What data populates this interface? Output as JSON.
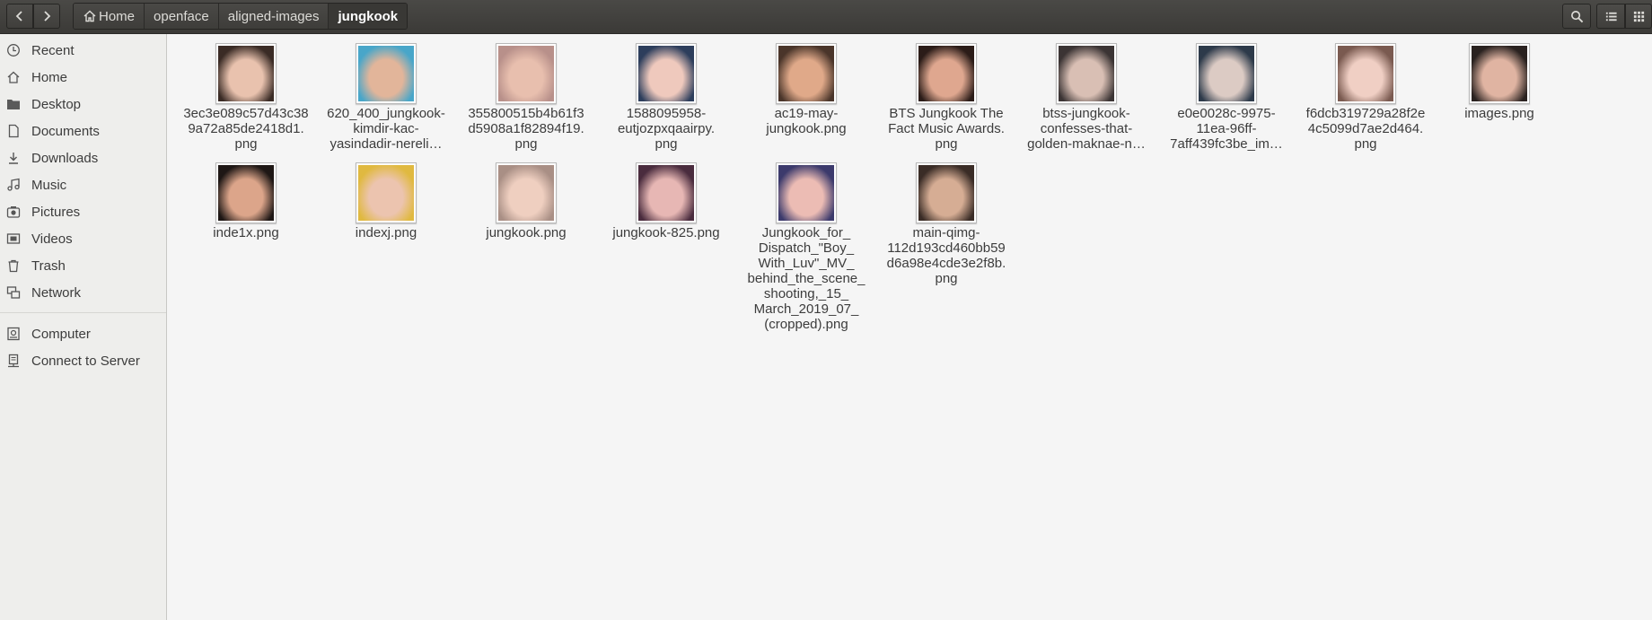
{
  "breadcrumb": [
    "Home",
    "openface",
    "aligned-images",
    "jungkook"
  ],
  "sidebar": {
    "items": [
      {
        "label": "Recent",
        "icon": "clock-icon"
      },
      {
        "label": "Home",
        "icon": "home-icon"
      },
      {
        "label": "Desktop",
        "icon": "folder-icon"
      },
      {
        "label": "Documents",
        "icon": "document-icon"
      },
      {
        "label": "Downloads",
        "icon": "download-icon"
      },
      {
        "label": "Music",
        "icon": "music-icon"
      },
      {
        "label": "Pictures",
        "icon": "camera-icon"
      },
      {
        "label": "Videos",
        "icon": "video-icon"
      },
      {
        "label": "Trash",
        "icon": "trash-icon"
      },
      {
        "label": "Network",
        "icon": "network-icon"
      }
    ],
    "devices": [
      {
        "label": "Computer",
        "icon": "computer-icon"
      },
      {
        "label": "Connect to Server",
        "icon": "server-icon"
      }
    ]
  },
  "files": [
    {
      "name": "3ec3e089c57d43c38\n9a72a85de2418d1.\npng",
      "tones": [
        "#e9c2ae",
        "#3a2b25"
      ]
    },
    {
      "name": "620_400_jungkook-\nkimdir-kac-\nyasindadir-nereli…",
      "tones": [
        "#e2b59a",
        "#48a6c9"
      ]
    },
    {
      "name": "355800515b4b61f3\nd5908a1f82894f19.\npng",
      "tones": [
        "#e8bfae",
        "#b8908a"
      ]
    },
    {
      "name": "1588095958-\neutjozpxqaairpy.\npng",
      "tones": [
        "#efc9bd",
        "#2d3e5c"
      ]
    },
    {
      "name": "ac19-may-\njungkook.png",
      "tones": [
        "#e0a989",
        "#4a352a"
      ]
    },
    {
      "name": "BTS Jungkook The\nFact Music Awards.\npng",
      "tones": [
        "#dfa78f",
        "#2b1c18"
      ]
    },
    {
      "name": "btss-jungkook-\nconfesses-that-\ngolden-maknae-n…",
      "tones": [
        "#d9bfb4",
        "#3b3434"
      ]
    },
    {
      "name": "e0e0028c-9975-\n11ea-96ff-\n7aff439fc3be_im…",
      "tones": [
        "#dccbc4",
        "#2d3a4a"
      ]
    },
    {
      "name": "f6dcb319729a28f2e\n4c5099d7ae2d464.\npng",
      "tones": [
        "#f0cfc4",
        "#7a5a50"
      ]
    },
    {
      "name": "images.png",
      "tones": [
        "#e0b4a2",
        "#2a2220"
      ]
    },
    {
      "name": "inde1x.png",
      "tones": [
        "#dca58a",
        "#1e1715"
      ]
    },
    {
      "name": "indexj.png",
      "tones": [
        "#ecc4af",
        "#e0b940"
      ]
    },
    {
      "name": "jungkook.png",
      "tones": [
        "#efcfc0",
        "#a98f85"
      ]
    },
    {
      "name": "jungkook-825.png",
      "tones": [
        "#e7b7b4",
        "#4a2c3e"
      ]
    },
    {
      "name": "Jungkook_for_\nDispatch_\"Boy_\nWith_Luv\"_MV_\nbehind_the_scene_\nshooting,_15_\nMarch_2019_07_\n(cropped).png",
      "tones": [
        "#ecbcb4",
        "#3c3a6c"
      ]
    },
    {
      "name": "main-qimg-\n112d193cd460bb59\nd6a98e4cde3e2f8b.\npng",
      "tones": [
        "#d6ad94",
        "#3a2c26"
      ]
    }
  ]
}
